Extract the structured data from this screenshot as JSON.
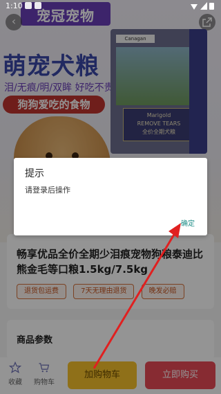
{
  "status_bar": {
    "time": "1:10"
  },
  "hero": {
    "brand": "宠冠宠物",
    "slogan": "萌宠犬粮",
    "tagline": "泪/无痕/明/双眸 好吃不贵",
    "pill": "狗狗爱吃的食物",
    "bag_logo": "Canagan",
    "bag_label_line1": "Marigold",
    "bag_label_line2": "REMOVE TEARS",
    "bag_label_line3": "全价全期犬粮"
  },
  "product": {
    "title": "畅享优品全价全期少泪痕宠物狗粮泰迪比熊金毛等口粮1.5kg/7.5kg",
    "tags": [
      "退货包运费",
      "7天无理由退货",
      "晚发必赔"
    ]
  },
  "params": {
    "heading": "商品参数"
  },
  "bottom_bar": {
    "favorite": "收藏",
    "cart": "购物车",
    "add_to_cart": "加购物车",
    "buy_now": "立即购买"
  },
  "dialog": {
    "title": "提示",
    "message": "请登录后操作",
    "confirm": "确定"
  },
  "colors": {
    "accent_teal": "#1c8c86",
    "cart_yellow": "#f6c12b",
    "buy_red": "#e84a57",
    "arrow_red": "#e02020"
  },
  "icons": [
    "back-arrow-icon",
    "share-icon",
    "star-icon",
    "cart-icon"
  ]
}
